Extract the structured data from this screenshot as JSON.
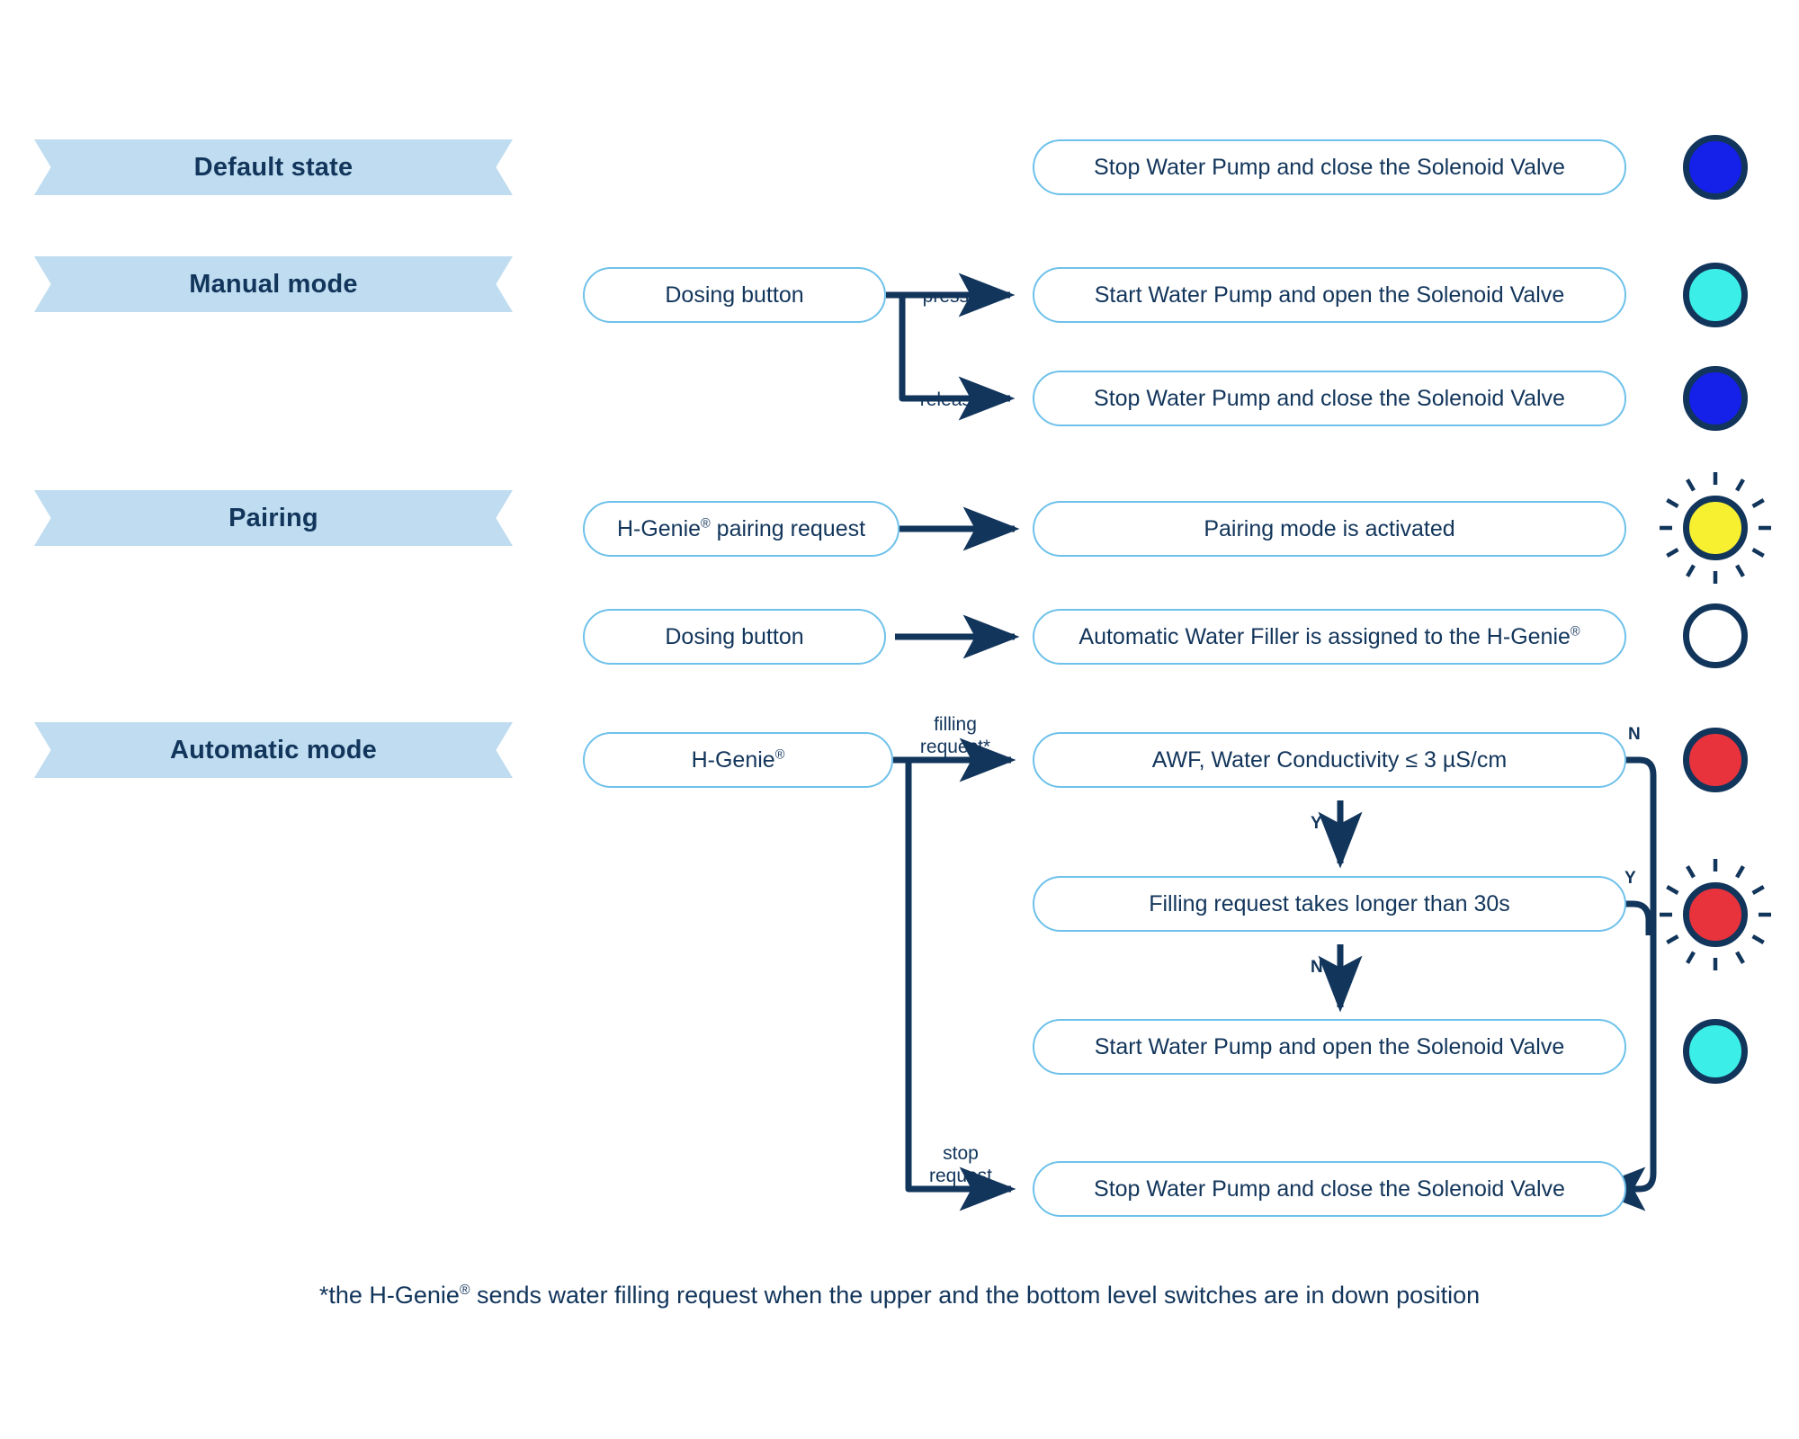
{
  "colors": {
    "banner_fill": "#bfdcf0",
    "navy": "#12355b",
    "pill_border": "#6ec1ea",
    "blue_led": "#1520e8",
    "cyan_led": "#3ceee8",
    "yellow_led": "#f7f030",
    "red_led": "#e8333d",
    "white_led": "#ffffff"
  },
  "sections": [
    {
      "id": "default-state",
      "label": "Default state"
    },
    {
      "id": "manual-mode",
      "label": "Manual mode"
    },
    {
      "id": "pairing",
      "label": "Pairing"
    },
    {
      "id": "automatic-mode",
      "label": "Automatic mode"
    }
  ],
  "nodes": {
    "default_action": "Stop Water Pump and close the Solenoid Valve",
    "manual_trigger": "Dosing button",
    "manual_pressed_action": "Start Water Pump and open the Solenoid Valve",
    "manual_released_action": "Stop Water Pump and close the Solenoid Valve",
    "pairing_trigger": "H-Genie® pairing request",
    "pairing_action": "Pairing mode is activated",
    "pairing_assign_trigger": "Dosing button",
    "pairing_assign_action": "Automatic Water Filler is assigned to the H-Genie®",
    "auto_trigger": "H-Genie®",
    "auto_check_conductivity": "AWF, Water Conductivity ≤ 3 µS/cm",
    "auto_check_timeout": "Filling request takes longer than 30s",
    "auto_start_action": "Start Water Pump and open the Solenoid Valve",
    "auto_stop_action": "Stop Water Pump and close the Solenoid Valve"
  },
  "edges": {
    "pressed": "pressed",
    "released": "released",
    "filling_request": "filling\nrequest*",
    "stop_request": "stop\nrequest",
    "conductivity_yes": "Y",
    "conductivity_no": "N",
    "timeout_yes": "Y",
    "timeout_no": "N"
  },
  "leds": [
    {
      "id": "led-default",
      "color": "#1520e8",
      "state": "solid",
      "name": "blue-led-icon"
    },
    {
      "id": "led-manual-pressed",
      "color": "#3ceee8",
      "state": "solid",
      "name": "cyan-led-icon"
    },
    {
      "id": "led-manual-released",
      "color": "#1520e8",
      "state": "solid",
      "name": "blue-led-icon"
    },
    {
      "id": "led-pairing",
      "color": "#f7f030",
      "state": "blinking",
      "name": "yellow-blinking-led-icon"
    },
    {
      "id": "led-assigned",
      "color": "#ffffff",
      "state": "solid",
      "name": "white-led-icon"
    },
    {
      "id": "led-conductivity-fail",
      "color": "#e8333d",
      "state": "solid",
      "name": "red-led-icon"
    },
    {
      "id": "led-timeout-fail",
      "color": "#e8333d",
      "state": "blinking",
      "name": "red-blinking-led-icon"
    },
    {
      "id": "led-auto-filling",
      "color": "#3ceee8",
      "state": "solid",
      "name": "cyan-led-icon"
    }
  ],
  "footnote": "*the H-Genie® sends water filling request when the upper and the bottom level switches are in down position"
}
